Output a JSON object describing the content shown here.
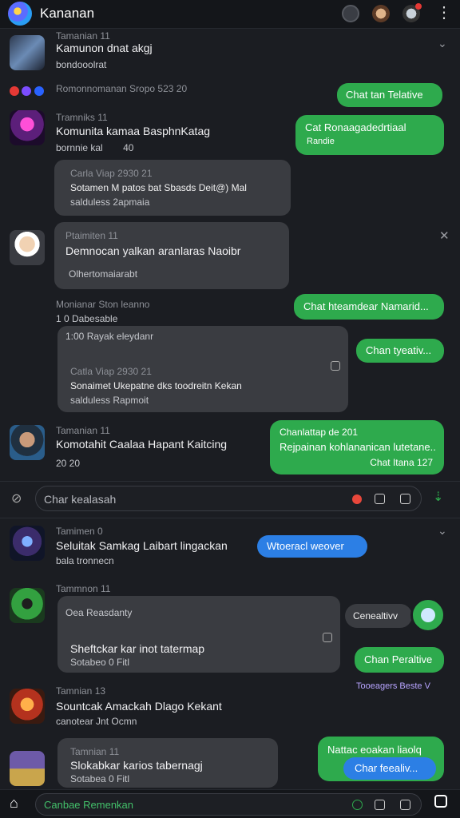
{
  "header": {
    "title": "Kananan"
  },
  "chats": {
    "c1": {
      "name": "Tamanian 11",
      "message": "Kamunon dnat akgj",
      "sub": "bondooolrat"
    },
    "row_emoji": {
      "text": "Romonnomanan Sropo 523 20"
    },
    "c2": {
      "name": "Tramniks 11",
      "message": "Komunita kamaa BasphnKatag",
      "sub": "bornnie kal",
      "count": "40"
    },
    "q1": {
      "name": "Carla Viap",
      "time": "2930 21",
      "line1": "Sotamen M patos bat Sbasds Deit@) Mal",
      "line2": "salduless 2apmaia"
    },
    "c3": {
      "name": "Ptaimiten 11",
      "message": "Demnocan yalkan aranlaras Naoibr",
      "sub": "Olhertomaiarabt"
    },
    "row2": {
      "label": "Monianar Ston leanno",
      "counts": "1 0 Dabesable"
    },
    "q2": {
      "header": "1:00 Rayak eleydanr",
      "name": "Catla Viap",
      "time": "2930 21",
      "line1": "Sonaimet Ukepatne dks toodreitn Kekan",
      "line2": "salduless Rapmoit"
    },
    "c4": {
      "name": "Tamanian 11",
      "message": "Komotahit Caalaa Hapant Kaitcing",
      "counts": "20 20"
    },
    "c5": {
      "name": "Tamimen 0",
      "message": "Seluitak Samkag Laibart lingackan",
      "sub": "bala tronnecn"
    },
    "q3": {
      "name": "Tammnon 11",
      "header": "Oea Reasdanty",
      "line1": "Sheftckar kar inot tatermap",
      "line2": "Sotabeo 0 Fitl"
    },
    "c6": {
      "name": "Tamnian 13",
      "message": "Sountcak Amackah Dlago Kekant",
      "sub": "canotear Jnt Ocmn"
    },
    "c7": {
      "name": "Tamnian 11",
      "message": "Slokabkar karios tabernagj",
      "sub": "Sotabea 0 Fitl"
    }
  },
  "green": {
    "g1": "Chat tan Telative",
    "g2_line1": "Cat Ronaagadedrtiaal",
    "g2_line2": "Randie",
    "g3": "Chat hteamdear Namarid...",
    "g4": "Chan tyeativ...",
    "g5_line1": "Chanlattap de 201",
    "g5_line2": "Rejpainan kohlananican lutetane..",
    "g5_line3": "Chat Itana 127",
    "g6": "Chan Peraltive",
    "g7": "Nattac eoakan liaolq"
  },
  "gray_reply": {
    "text": "Cenealtivv"
  },
  "blue": {
    "b1": "Wtoeracl weover",
    "b2": "Char feealiv..."
  },
  "mid_input": {
    "placeholder": "Char kealasah"
  },
  "bottom_input": {
    "placeholder": "Canbae Remenkan"
  },
  "status_row": {
    "text": "Tooeagers Beste V"
  }
}
